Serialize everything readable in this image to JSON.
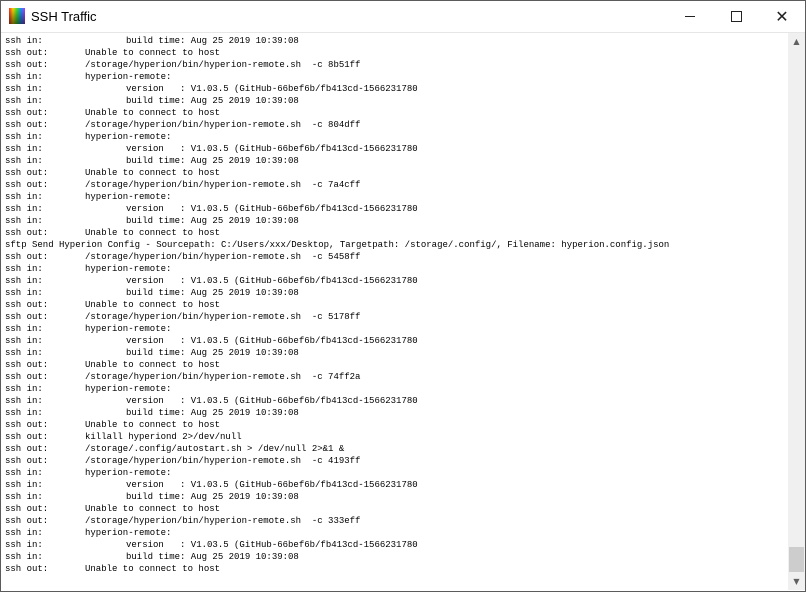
{
  "window": {
    "title": "SSH Traffic",
    "icons": {
      "app": "rainbow-app-icon",
      "minimize": "minimize-icon",
      "maximize": "maximize-icon",
      "close": "close-icon",
      "close_glyph": "✕",
      "scroll_up_glyph": "▲",
      "scroll_down_glyph": "▼"
    }
  },
  "log": {
    "lines": [
      {
        "kind": "ssh in:",
        "msg": "version   : V1.03.5 (GitHub-66bef6b/fb413cd-1566231780",
        "indent": true
      },
      {
        "kind": "ssh in:",
        "msg": "build time: Aug 25 2019 10:39:08",
        "indent": true
      },
      {
        "kind": "ssh out:",
        "msg": "Unable to connect to host",
        "indent": false
      },
      {
        "kind": "ssh out:",
        "msg": "/storage/hyperion/bin/hyperion-remote.sh  -c 8b51ff",
        "indent": false
      },
      {
        "kind": "ssh in:",
        "msg": "hyperion-remote:",
        "indent": false
      },
      {
        "kind": "ssh in:",
        "msg": "version   : V1.03.5 (GitHub-66bef6b/fb413cd-1566231780",
        "indent": true
      },
      {
        "kind": "ssh in:",
        "msg": "build time: Aug 25 2019 10:39:08",
        "indent": true
      },
      {
        "kind": "ssh out:",
        "msg": "Unable to connect to host",
        "indent": false
      },
      {
        "kind": "ssh out:",
        "msg": "/storage/hyperion/bin/hyperion-remote.sh  -c 804dff",
        "indent": false
      },
      {
        "kind": "ssh in:",
        "msg": "hyperion-remote:",
        "indent": false
      },
      {
        "kind": "ssh in:",
        "msg": "version   : V1.03.5 (GitHub-66bef6b/fb413cd-1566231780",
        "indent": true
      },
      {
        "kind": "ssh in:",
        "msg": "build time: Aug 25 2019 10:39:08",
        "indent": true
      },
      {
        "kind": "ssh out:",
        "msg": "Unable to connect to host",
        "indent": false
      },
      {
        "kind": "ssh out:",
        "msg": "/storage/hyperion/bin/hyperion-remote.sh  -c 7a4cff",
        "indent": false
      },
      {
        "kind": "ssh in:",
        "msg": "hyperion-remote:",
        "indent": false
      },
      {
        "kind": "ssh in:",
        "msg": "version   : V1.03.5 (GitHub-66bef6b/fb413cd-1566231780",
        "indent": true
      },
      {
        "kind": "ssh in:",
        "msg": "build time: Aug 25 2019 10:39:08",
        "indent": true
      },
      {
        "kind": "ssh out:",
        "msg": "Unable to connect to host",
        "indent": false
      },
      {
        "kind": "",
        "msg": "sftp Send Hyperion Config - Sourcepath: C:/Users/xxx/Desktop, Targetpath: /storage/.config/, Filename: hyperion.config.json",
        "indent": false,
        "sftp": true
      },
      {
        "kind": "ssh out:",
        "msg": "/storage/hyperion/bin/hyperion-remote.sh  -c 5458ff",
        "indent": false
      },
      {
        "kind": "ssh in:",
        "msg": "hyperion-remote:",
        "indent": false
      },
      {
        "kind": "ssh in:",
        "msg": "version   : V1.03.5 (GitHub-66bef6b/fb413cd-1566231780",
        "indent": true
      },
      {
        "kind": "ssh in:",
        "msg": "build time: Aug 25 2019 10:39:08",
        "indent": true
      },
      {
        "kind": "ssh out:",
        "msg": "Unable to connect to host",
        "indent": false
      },
      {
        "kind": "ssh out:",
        "msg": "/storage/hyperion/bin/hyperion-remote.sh  -c 5178ff",
        "indent": false
      },
      {
        "kind": "ssh in:",
        "msg": "hyperion-remote:",
        "indent": false
      },
      {
        "kind": "ssh in:",
        "msg": "version   : V1.03.5 (GitHub-66bef6b/fb413cd-1566231780",
        "indent": true
      },
      {
        "kind": "ssh in:",
        "msg": "build time: Aug 25 2019 10:39:08",
        "indent": true
      },
      {
        "kind": "ssh out:",
        "msg": "Unable to connect to host",
        "indent": false
      },
      {
        "kind": "ssh out:",
        "msg": "/storage/hyperion/bin/hyperion-remote.sh  -c 74ff2a",
        "indent": false
      },
      {
        "kind": "ssh in:",
        "msg": "hyperion-remote:",
        "indent": false
      },
      {
        "kind": "ssh in:",
        "msg": "version   : V1.03.5 (GitHub-66bef6b/fb413cd-1566231780",
        "indent": true
      },
      {
        "kind": "ssh in:",
        "msg": "build time: Aug 25 2019 10:39:08",
        "indent": true
      },
      {
        "kind": "ssh out:",
        "msg": "Unable to connect to host",
        "indent": false
      },
      {
        "kind": "ssh out:",
        "msg": "killall hyperiond 2>/dev/null",
        "indent": false
      },
      {
        "kind": "ssh out:",
        "msg": "/storage/.config/autostart.sh > /dev/null 2>&1 &",
        "indent": false
      },
      {
        "kind": "ssh out:",
        "msg": "/storage/hyperion/bin/hyperion-remote.sh  -c 4193ff",
        "indent": false
      },
      {
        "kind": "ssh in:",
        "msg": "hyperion-remote:",
        "indent": false
      },
      {
        "kind": "ssh in:",
        "msg": "version   : V1.03.5 (GitHub-66bef6b/fb413cd-1566231780",
        "indent": true
      },
      {
        "kind": "ssh in:",
        "msg": "build time: Aug 25 2019 10:39:08",
        "indent": true
      },
      {
        "kind": "ssh out:",
        "msg": "Unable to connect to host",
        "indent": false
      },
      {
        "kind": "ssh out:",
        "msg": "/storage/hyperion/bin/hyperion-remote.sh  -c 333eff",
        "indent": false
      },
      {
        "kind": "ssh in:",
        "msg": "hyperion-remote:",
        "indent": false
      },
      {
        "kind": "ssh in:",
        "msg": "version   : V1.03.5 (GitHub-66bef6b/fb413cd-1566231780",
        "indent": true
      },
      {
        "kind": "ssh in:",
        "msg": "build time: Aug 25 2019 10:39:08",
        "indent": true
      },
      {
        "kind": "ssh out:",
        "msg": "Unable to connect to host",
        "indent": false
      }
    ]
  },
  "scrollbar": {
    "position_fraction": 0.97
  }
}
